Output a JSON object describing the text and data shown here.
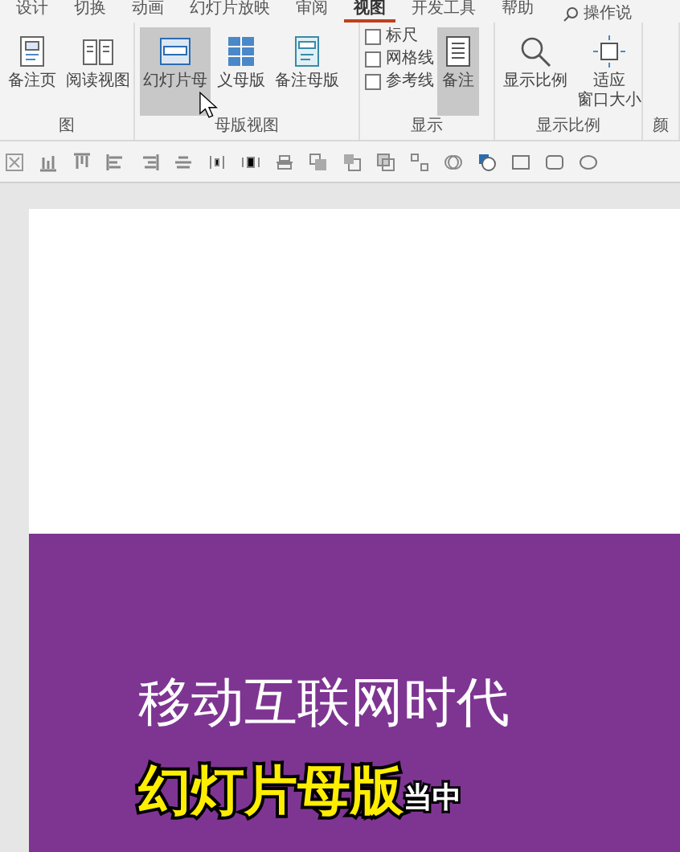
{
  "tabs": [
    {
      "label": "设计",
      "selected": false
    },
    {
      "label": "切换",
      "selected": false
    },
    {
      "label": "动画",
      "selected": false
    },
    {
      "label": "幻灯片放映",
      "selected": false
    },
    {
      "label": "审阅",
      "selected": false
    },
    {
      "label": "视图",
      "selected": true
    },
    {
      "label": "开发工具",
      "selected": false
    },
    {
      "label": "帮助",
      "selected": false
    }
  ],
  "search": {
    "placeholder": "操作说"
  },
  "ribbon_groups": [
    {
      "label": "图",
      "items": [
        {
          "kind": "button",
          "label": "备注页",
          "selected": false
        },
        {
          "kind": "button",
          "label": "阅读视图",
          "selected": false
        }
      ]
    },
    {
      "label": "母版视图",
      "items": [
        {
          "kind": "button",
          "label": "幻灯片母",
          "selected": true
        },
        {
          "kind": "button",
          "label": "义母版",
          "selected": false
        },
        {
          "kind": "button",
          "label": "备注母版",
          "selected": false
        }
      ]
    },
    {
      "label": "显示",
      "items": [
        {
          "kind": "checkbox",
          "label": "标尺",
          "checked": false
        },
        {
          "kind": "checkbox",
          "label": "网格线",
          "checked": false
        },
        {
          "kind": "checkbox",
          "label": "参考线",
          "checked": false
        },
        {
          "kind": "button",
          "label": "备注",
          "selected": true
        }
      ]
    },
    {
      "label": "显示比例",
      "items": [
        {
          "kind": "button",
          "label": "显示比例",
          "selected": false
        },
        {
          "kind": "button",
          "label_lines": [
            "适应",
            "窗口大小"
          ],
          "selected": false
        }
      ]
    },
    {
      "label": "颜"
    }
  ],
  "slide": {
    "title": "移动互联网时代"
  },
  "caption": {
    "highlight": "幻灯片母版",
    "rest": "当中"
  }
}
